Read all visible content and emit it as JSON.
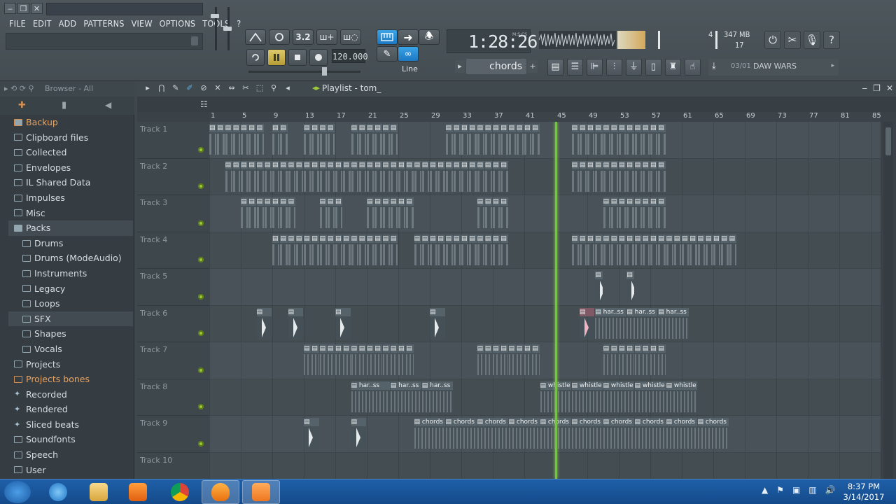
{
  "window": {
    "min_label": "‒",
    "restore_label": "❐",
    "close_label": "✕"
  },
  "menu": [
    "FILE",
    "EDIT",
    "ADD",
    "PATTERNS",
    "VIEW",
    "OPTIONS",
    "TOOLS",
    "?"
  ],
  "transport": {
    "tempo": "120.000",
    "song_time": "1:28:26",
    "time_format": "M:S:CS",
    "snap_mode": "Line",
    "pattern_name": "chords",
    "memory": "347 MB",
    "cpu_number": "4",
    "polyphony": "17"
  },
  "hint": {
    "number": "03/01",
    "title": "DAW WARS"
  },
  "browser": {
    "title": "Browser - All",
    "items": [
      {
        "label": "Backup",
        "style": "orange open"
      },
      {
        "label": "Clipboard files",
        "style": ""
      },
      {
        "label": "Collected",
        "style": ""
      },
      {
        "label": "Envelopes",
        "style": ""
      },
      {
        "label": "IL Shared Data",
        "style": ""
      },
      {
        "label": "Impulses",
        "style": ""
      },
      {
        "label": "Misc",
        "style": ""
      },
      {
        "label": "Packs",
        "style": "open active"
      },
      {
        "label": "Drums",
        "style": "sub"
      },
      {
        "label": "Drums (ModeAudio)",
        "style": "sub"
      },
      {
        "label": "Instruments",
        "style": "sub"
      },
      {
        "label": "Legacy",
        "style": "sub"
      },
      {
        "label": "Loops",
        "style": "sub"
      },
      {
        "label": "SFX",
        "style": "sub active"
      },
      {
        "label": "Shapes",
        "style": "sub"
      },
      {
        "label": "Vocals",
        "style": "sub"
      },
      {
        "label": "Projects",
        "style": ""
      },
      {
        "label": "Projects bones",
        "style": "orange"
      },
      {
        "label": "Recorded",
        "style": "star"
      },
      {
        "label": "Rendered",
        "style": "star"
      },
      {
        "label": "Sliced beats",
        "style": "star"
      },
      {
        "label": "Soundfonts",
        "style": ""
      },
      {
        "label": "Speech",
        "style": ""
      },
      {
        "label": "User",
        "style": ""
      }
    ]
  },
  "playlist": {
    "title": "Playlist - tom_",
    "bar_numbers": [
      "1",
      "5",
      "9",
      "13",
      "17",
      "21",
      "25",
      "29",
      "33",
      "37",
      "41",
      "45",
      "49",
      "53",
      "57",
      "61",
      "65",
      "69",
      "73",
      "77",
      "81",
      "85"
    ],
    "tracks": [
      "Track 1",
      "Track 2",
      "Track 3",
      "Track 4",
      "Track 5",
      "Track 6",
      "Track 7",
      "Track 8",
      "Track 9",
      "Track 10"
    ],
    "clip_labels": {
      "harp": "har..ss",
      "whistle": "whistle",
      "chords": "chords"
    },
    "playhead_bar": 45
  },
  "taskbar": {
    "time": "8:37 PM",
    "date": "3/14/2017"
  }
}
